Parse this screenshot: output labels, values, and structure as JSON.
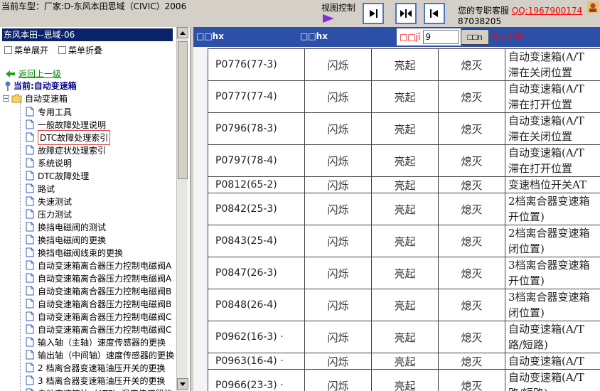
{
  "topbar": {
    "title": "当前车型：厂家:D-东风本田思域（CIVIC）2006",
    "view_control": "视图控制",
    "service_label": "您的专职客服",
    "qq": "QQ:1967900174",
    "phone": "87038205"
  },
  "left": {
    "vehicle": "东风本田--思域-06",
    "expand_label": "菜单展开",
    "collapse_label": "菜单折叠",
    "back_label": "返回上一级",
    "current_label": "当前:自动变速箱",
    "folder_label": "自动变速箱",
    "items": [
      "专用工具",
      "一般故障处理说明",
      "DTC故障处理索引",
      "故障症状处理索引",
      "系统说明",
      "DTC故障处理",
      "路试",
      "失速测试",
      "压力测试",
      "换挡电磁阀的测试",
      "换挡电磁阀的更换",
      "换挡电磁阀线束的更换",
      "自动变速箱离合器压力控制电磁阀A",
      "自动变速箱离合器压力控制电磁阀A",
      "自动变速箱离合器压力控制电磁阀B",
      "自动变速箱离合器压力控制电磁阀B",
      "自动变速箱离合器压力控制电磁阀C",
      "自动变速箱离合器压力控制电磁阀C",
      "输入轴（主轴）速度传感器的更换",
      "输出轴（中间轴）速度传感器的更换",
      "2 档离合器变速箱油压开关的更换",
      "3 档离合器变速箱油压开关的更换",
      "自动变速箱油（ATF）温度传感器的"
    ],
    "selected_index": 2
  },
  "right": {
    "header1": "□□hx",
    "header2": "□□hx",
    "page_label": "□□jǐ",
    "page_value": "9",
    "go_label": "□□n",
    "page_total": "9 / 348"
  },
  "doc_rows": [
    {
      "code": "P0776(77-3)",
      "c1": "闪烁",
      "c2": "亮起",
      "c3": "熄灭",
      "desc1": "自动变速箱(A/T",
      "desc2": "滞在关闭位置"
    },
    {
      "code": "P0777(77-4)",
      "c1": "闪烁",
      "c2": "亮起",
      "c3": "熄灭",
      "desc1": "自动变速箱(A/T",
      "desc2": "滞在打开位置"
    },
    {
      "code": "P0796(78-3)",
      "c1": "闪烁",
      "c2": "亮起",
      "c3": "熄灭",
      "desc1": "自动变速箱(A/T",
      "desc2": "滞在关闭位置"
    },
    {
      "code": "P0797(78-4)",
      "c1": "闪烁",
      "c2": "亮起",
      "c3": "熄灭",
      "desc1": "自动变速箱(A/T",
      "desc2": "滞在打开位置"
    },
    {
      "code": "P0812(65-2)",
      "c1": "闪烁",
      "c2": "亮起",
      "c3": "熄灭",
      "desc1": "变速档位开关AT",
      "desc2": ""
    },
    {
      "code": "P0842(25-3)",
      "c1": "闪烁",
      "c2": "亮起",
      "c3": "熄灭",
      "desc1": "2档离合器变速箱",
      "desc2": "开位置)"
    },
    {
      "code": "P0843(25-4)",
      "c1": "闪烁",
      "c2": "亮起",
      "c3": "熄灭",
      "desc1": "2档离合器变速箱",
      "desc2": "闭位置)"
    },
    {
      "code": "P0847(26-3)",
      "c1": "闪烁",
      "c2": "亮起",
      "c3": "熄灭",
      "desc1": "3档离合器变速箱",
      "desc2": "开位置)"
    },
    {
      "code": "P0848(26-4)",
      "c1": "闪烁",
      "c2": "亮起",
      "c3": "熄灭",
      "desc1": "3档离合器变速箱",
      "desc2": "闭位置)"
    },
    {
      "code": "P0962(16-3) ·",
      "c1": "闪烁",
      "c2": "亮起",
      "c3": "熄灭",
      "desc1": "自动变速箱(A/T",
      "desc2": "路/短路)"
    },
    {
      "code": "P0963(16-4) ·",
      "c1": "闪烁",
      "c2": "亮起",
      "c3": "熄灭",
      "desc1": "自动变速箱(A/T",
      "desc2": ""
    },
    {
      "code": "P0966(23-3) ·",
      "c1": "闪烁",
      "c2": "亮起",
      "c3": "熄灭",
      "desc1": "自动变速箱(A/T",
      "desc2": "路/短路)"
    }
  ],
  "icons": {
    "back": "green-arrow-left-icon",
    "current": "pin-icon",
    "folder": "open-folder-icon",
    "doc": "document-icon"
  }
}
